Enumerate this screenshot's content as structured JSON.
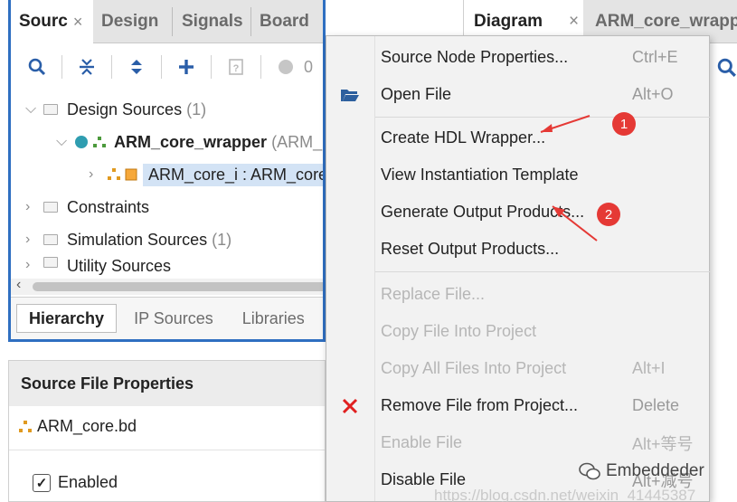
{
  "left_panel": {
    "tabs": [
      {
        "label": "Sourc",
        "close": "×"
      },
      {
        "label": "Design"
      },
      {
        "label": "Signals"
      },
      {
        "label": "Board"
      }
    ],
    "tab_controls": [
      "?",
      "–",
      "☐",
      "⧉"
    ],
    "toolbar": {
      "icons": [
        "search-icon",
        "collapse-all-icon",
        "expand-all-icon",
        "add-icon",
        "properties-icon",
        "status-dot-icon"
      ],
      "count": "0"
    },
    "tree": {
      "design_sources": {
        "label": "Design Sources",
        "count": "(1)"
      },
      "wrapper": {
        "label": "ARM_core_wrapper",
        "suffix": "(ARM_"
      },
      "instance": {
        "label": "ARM_core_i : ARM_core"
      },
      "constraints": {
        "label": "Constraints"
      },
      "simulation": {
        "label": "Simulation Sources",
        "count": "(1)"
      },
      "utility": {
        "label": "Utility Sources"
      }
    },
    "bottom_tabs": [
      "Hierarchy",
      "IP Sources",
      "Libraries"
    ]
  },
  "properties": {
    "title": "Source File Properties",
    "file": "ARM_core.bd",
    "enabled_label": "Enabled"
  },
  "right_panel": {
    "tabs": [
      {
        "label": "Diagram",
        "close": "×"
      },
      {
        "label": "ARM_core_wrappe"
      }
    ]
  },
  "context_menu": {
    "items": [
      {
        "label": "Source Node Properties...",
        "shortcut": "Ctrl+E",
        "enabled": true
      },
      {
        "label": "Open File",
        "shortcut": "Alt+O",
        "enabled": true,
        "icon": "open-folder-icon"
      },
      {
        "label": "Create HDL Wrapper...",
        "shortcut": "",
        "enabled": true
      },
      {
        "label": "View Instantiation Template",
        "shortcut": "",
        "enabled": true
      },
      {
        "label": "Generate Output Products...",
        "shortcut": "",
        "enabled": true
      },
      {
        "label": "Reset Output Products...",
        "shortcut": "",
        "enabled": true
      },
      {
        "label": "Replace File...",
        "shortcut": "",
        "enabled": false
      },
      {
        "label": "Copy File Into Project",
        "shortcut": "",
        "enabled": false
      },
      {
        "label": "Copy All Files Into Project",
        "shortcut": "Alt+I",
        "enabled": false
      },
      {
        "label": "Remove File from Project...",
        "shortcut": "Delete",
        "enabled": true,
        "icon": "red-x-icon"
      },
      {
        "label": "Enable File",
        "shortcut": "Alt+等号",
        "enabled": false
      },
      {
        "label": "Disable File",
        "shortcut": "Alt+减号",
        "enabled": true
      }
    ]
  },
  "annotations": {
    "badge1": "1",
    "badge2": "2"
  },
  "watermark": {
    "text": "Embeddeder",
    "url": "https://blog.csdn.net/weixin_41445387"
  },
  "colors": {
    "accent": "#2f6fc1",
    "annotation_red": "#e53935",
    "selection": "#d3e3f5"
  }
}
